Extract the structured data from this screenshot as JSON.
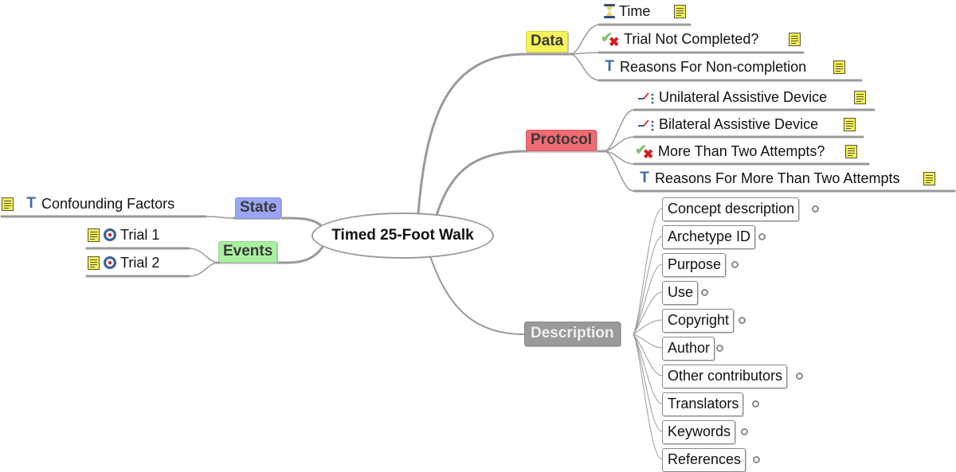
{
  "root": {
    "label": "Timed 25-Foot Walk"
  },
  "colors": {
    "data": "#f6f25a",
    "protocol": "#f26a74",
    "description": "#9a9a9a",
    "state": "#9aa6f4",
    "events": "#a8f0a0",
    "line": "#9a9a9a"
  },
  "branches": {
    "data": {
      "label": "Data",
      "children": [
        {
          "label": "Time",
          "icon": "hourglass-icon",
          "note": true
        },
        {
          "label": "Trial Not Completed?",
          "icon": "boolean-check-x-icon",
          "note": true
        },
        {
          "label": "Reasons For Non-completion",
          "icon": "text-T-icon",
          "note": true
        }
      ]
    },
    "protocol": {
      "label": "Protocol",
      "children": [
        {
          "label": "Unilateral Assistive Device",
          "icon": "ordinal-graph-icon",
          "note": true
        },
        {
          "label": "Bilateral Assistive Device",
          "icon": "ordinal-graph-icon",
          "note": true
        },
        {
          "label": "More Than Two Attempts?",
          "icon": "boolean-check-x-icon",
          "note": true
        },
        {
          "label": "Reasons For More Than Two Attempts",
          "icon": "text-T-icon",
          "note": true
        }
      ]
    },
    "description": {
      "label": "Description",
      "children": [
        {
          "label": "Concept description"
        },
        {
          "label": "Archetype ID"
        },
        {
          "label": "Purpose"
        },
        {
          "label": "Use"
        },
        {
          "label": "Copyright"
        },
        {
          "label": "Author"
        },
        {
          "label": "Other contributors"
        },
        {
          "label": "Translators"
        },
        {
          "label": "Keywords"
        },
        {
          "label": "References"
        }
      ]
    },
    "state": {
      "label": "State",
      "children": [
        {
          "label": "Confounding Factors",
          "icon": "text-T-icon",
          "note": true
        }
      ]
    },
    "events": {
      "label": "Events",
      "children": [
        {
          "label": "Trial 1",
          "icon": "target-event-icon",
          "note": true
        },
        {
          "label": "Trial 2",
          "icon": "target-event-icon",
          "note": true
        }
      ]
    }
  }
}
